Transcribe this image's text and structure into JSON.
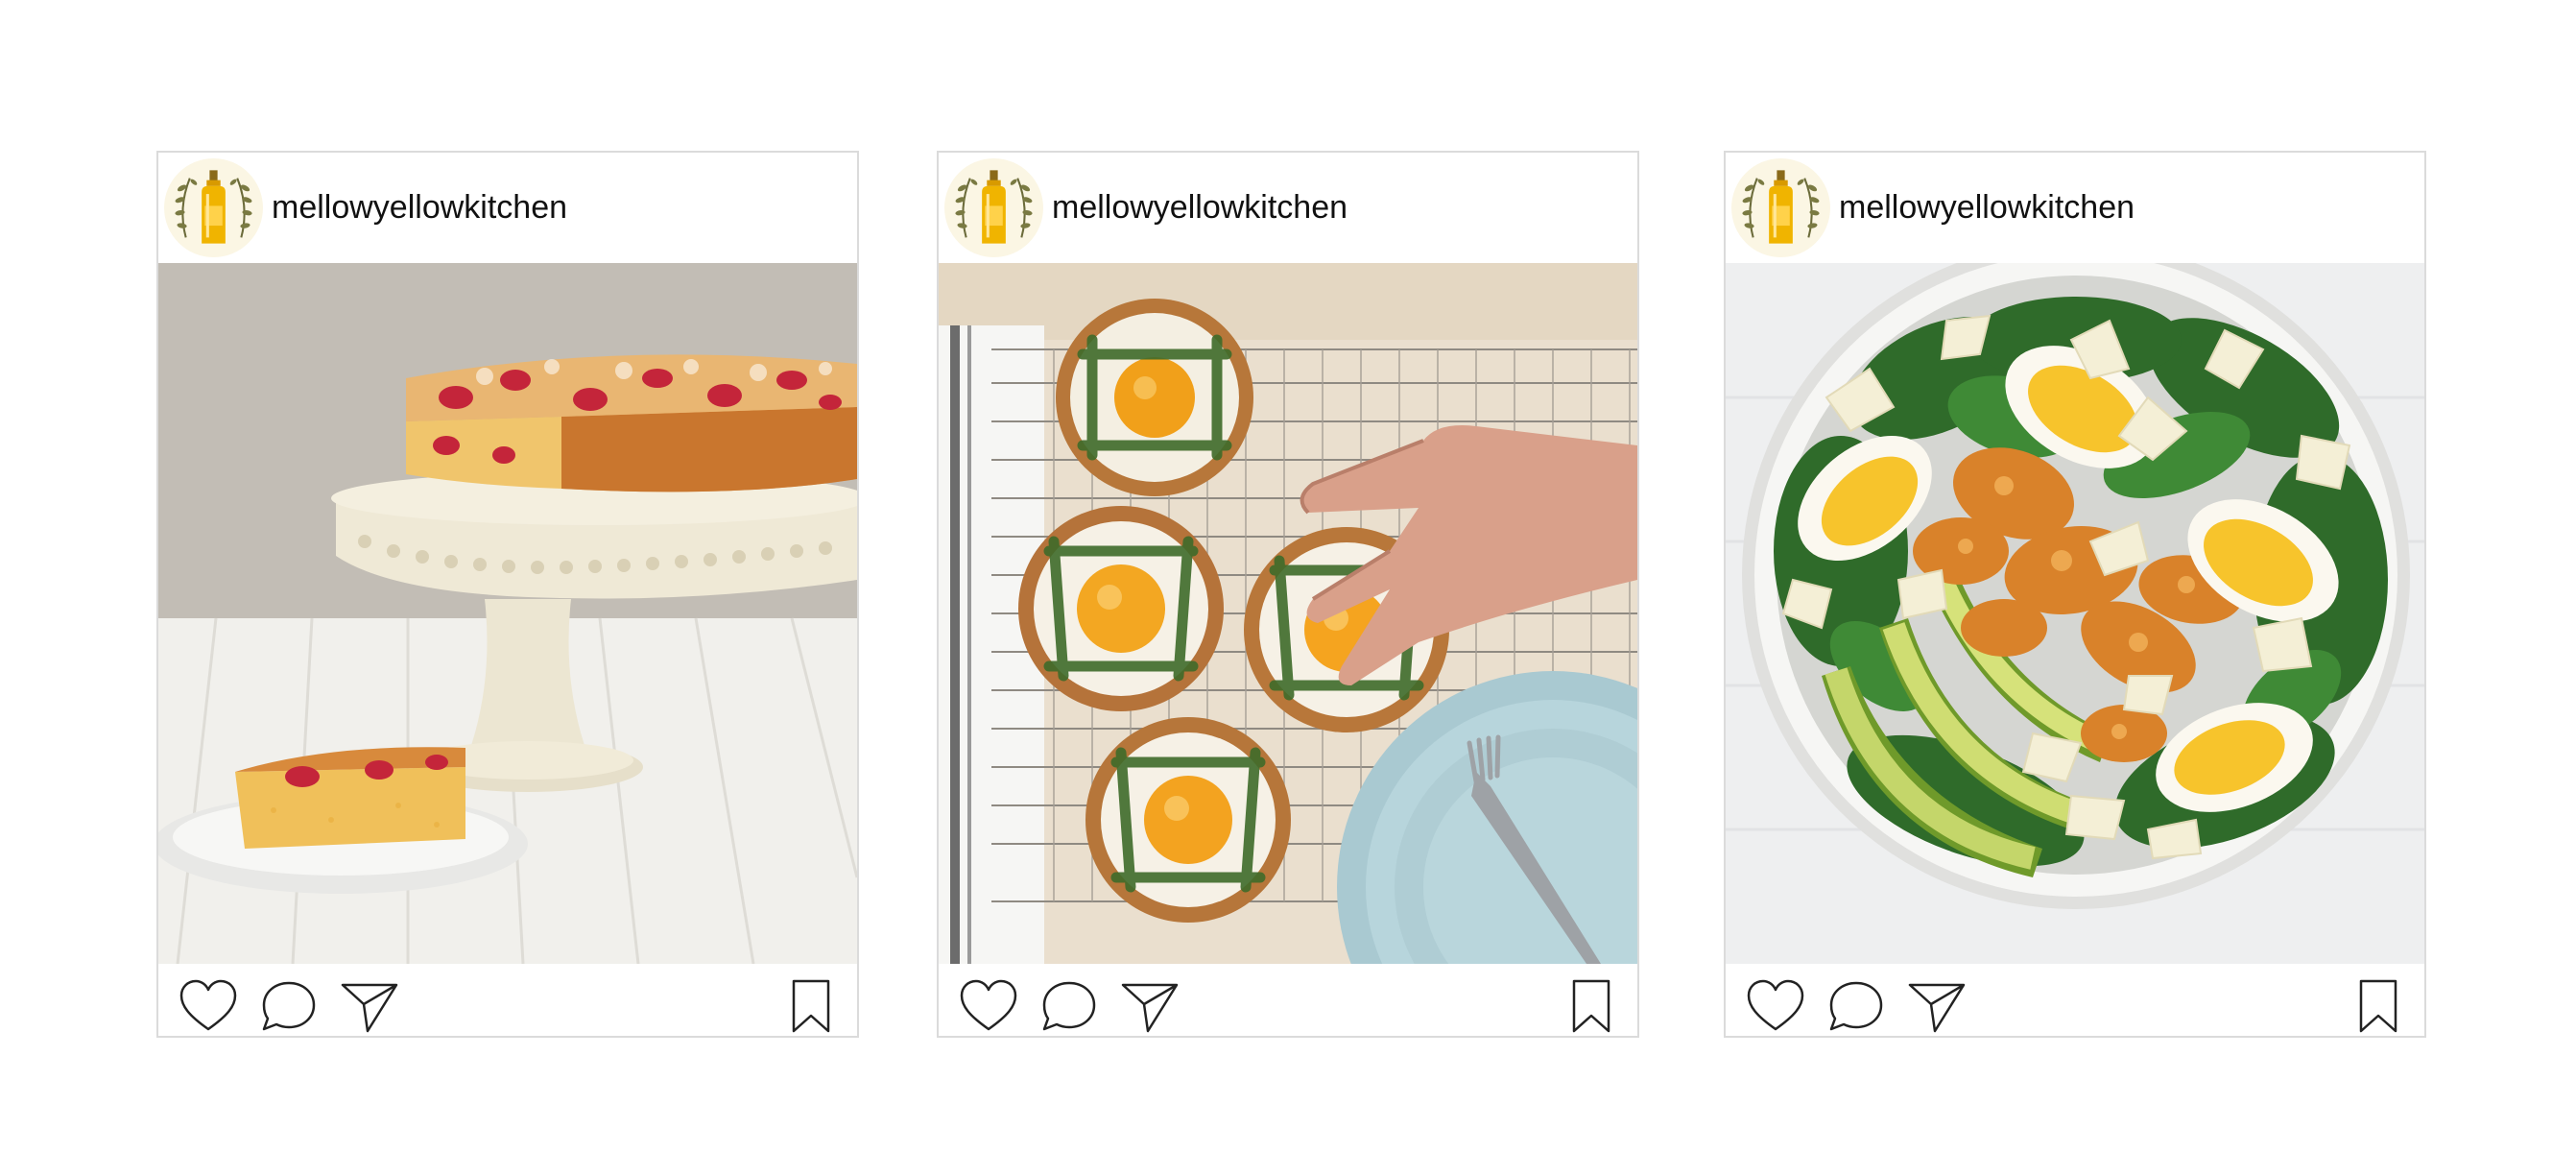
{
  "posts": [
    {
      "username": "mellowyellowkitchen",
      "image": "strawberry cake on a cream cake stand with a slice on a white plate",
      "icons": [
        "heart-icon",
        "comment-icon",
        "share-icon",
        "bookmark-icon"
      ]
    },
    {
      "username": "mellowyellowkitchen",
      "image": "four egg and asparagus tartlets on a cooling rack, a hand and a blue plate with fork",
      "icons": [
        "heart-icon",
        "comment-icon",
        "share-icon",
        "bookmark-icon"
      ]
    },
    {
      "username": "mellowyellowkitchen",
      "image": "salad bowl with spinach, boiled eggs, avocado, crispy chicken and parmesan",
      "icons": [
        "heart-icon",
        "comment-icon",
        "share-icon",
        "bookmark-icon"
      ]
    }
  ],
  "colors": {
    "border": "#dbdbdb",
    "icon_stroke": "#222222",
    "text": "#111111",
    "avatar_leaf": "#6b6b3a",
    "avatar_bottle": "#f0b400"
  }
}
